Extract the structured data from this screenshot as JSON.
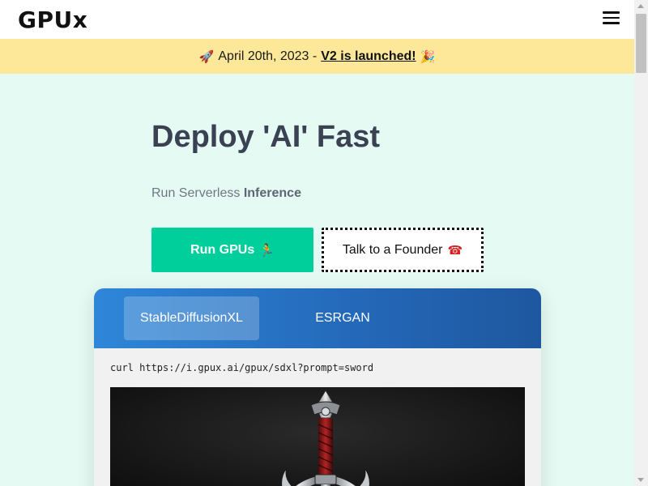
{
  "header": {
    "logo": "GPUx",
    "menu_icon": "hamburger-menu-icon"
  },
  "banner": {
    "rocket_emoji": "🚀",
    "date_text": "April 20th, 2023 -",
    "link_text": "V2 is launched!",
    "party_emoji": "🎉",
    "background": "#fde89a"
  },
  "hero": {
    "title": "Deploy 'AI' Fast",
    "subtitle_prefix": "Run Serverless",
    "subtitle_bold": "Inference",
    "primary_button": {
      "label": "Run GPUs",
      "emoji": "🏃",
      "color": "#00cf9b"
    },
    "secondary_button": {
      "label": "Talk to a Founder",
      "emoji": "☎"
    }
  },
  "demo_card": {
    "tabs": [
      {
        "label": "StableDiffusionXL",
        "active": true
      },
      {
        "label": "ESRGAN",
        "active": false
      }
    ],
    "curl_command": "curl https://i.gpux.ai/gpux/sdxl?prompt=sword",
    "image_subject": "sword"
  },
  "colors": {
    "page_background": "#e6faf4",
    "title_text": "#3a4152",
    "tab_gradient_start": "#2f86d8",
    "tab_gradient_end": "#1e579f"
  }
}
